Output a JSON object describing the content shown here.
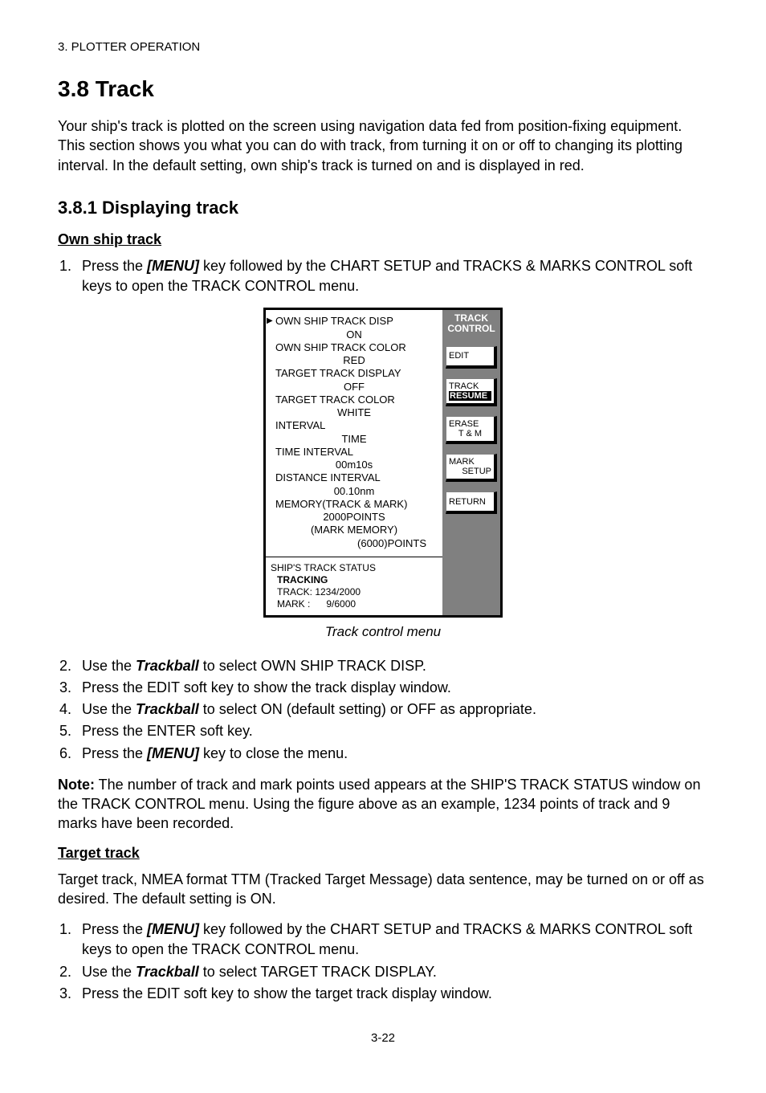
{
  "header": "3. PLOTTER OPERATION",
  "section_title": "3.8 Track",
  "intro": "Your ship's track is plotted on the screen using navigation data fed from position-fixing equipment. This section shows you what you can do with track, from turning it on or off to changing its plotting interval. In the default setting, own ship's track is turned on and is displayed in red.",
  "subsection_title": "3.8.1 Displaying track",
  "own_heading": "Own ship track",
  "own_steps": {
    "s1a": "Press the ",
    "s1key": "[MENU]",
    "s1b": " key followed by the CHART SETUP and TRACKS & MARKS CONTROL soft keys to open the TRACK CONTROL menu.",
    "s2a": "Use the ",
    "s2key": "Trackball",
    "s2b": " to select OWN SHIP TRACK DISP.",
    "s3": "Press the EDIT soft key to show the track display window.",
    "s4a": "Use the ",
    "s4key": "Trackball",
    "s4b": " to select ON (default setting) or OFF as appropriate.",
    "s5": "Press the ENTER soft key.",
    "s6a": "Press the ",
    "s6key": "[MENU]",
    "s6b": " key to close the menu."
  },
  "note_label": "Note:",
  "note_body": " The number of track and mark points used appears at the SHIP'S TRACK STATUS window on the TRACK CONTROL menu. Using the figure above as an example, 1234 points of track and 9 marks have been recorded.",
  "target_heading": "Target track",
  "target_intro": "Target track, NMEA format TTM (Tracked Target Message) data sentence, may be turned on or off as desired. The default setting is ON.",
  "target_steps": {
    "s1a": "Press the ",
    "s1key": "[MENU]",
    "s1b": " key followed by the CHART SETUP and TRACKS & MARKS CONTROL soft keys to open the TRACK CONTROL menu.",
    "s2a": "Use the ",
    "s2key": "Trackball",
    "s2b": " to select TARGET TRACK DISPLAY.",
    "s3": "Press the EDIT soft key to show the target track display window."
  },
  "menu": {
    "items": [
      {
        "label": "OWN SHIP TRACK DISP",
        "value": "ON",
        "pointer": true
      },
      {
        "label": "OWN SHIP TRACK COLOR",
        "value": "RED"
      },
      {
        "label": "TARGET TRACK DISPLAY",
        "value": "OFF"
      },
      {
        "label": "TARGET TRACK COLOR",
        "value": "WHITE"
      },
      {
        "label": "INTERVAL",
        "value": "TIME"
      },
      {
        "label": "TIME INTERVAL",
        "value": "00m10s"
      },
      {
        "label": "DISTANCE INTERVAL",
        "value": "00.10nm"
      },
      {
        "label": "MEMORY(TRACK & MARK)",
        "value": "2000POINTS"
      }
    ],
    "extra1": "(MARK MEMORY)",
    "extra2": "(6000)POINTS",
    "status_title": "SHIP'S TRACK STATUS",
    "status_mode": "TRACKING",
    "status_track": "TRACK: 1234/2000",
    "status_mark": "MARK :      9/6000",
    "sk_title1": "TRACK",
    "sk_title2": "CONTROL",
    "softkeys": {
      "edit": "EDIT",
      "track": "TRACK",
      "resume": "RESUME",
      "erase1": "ERASE",
      "erase2": "T & M",
      "mark1": "MARK",
      "mark2": "SETUP",
      "return": "RETURN"
    }
  },
  "caption": "Track control menu",
  "page_number": "3-22"
}
